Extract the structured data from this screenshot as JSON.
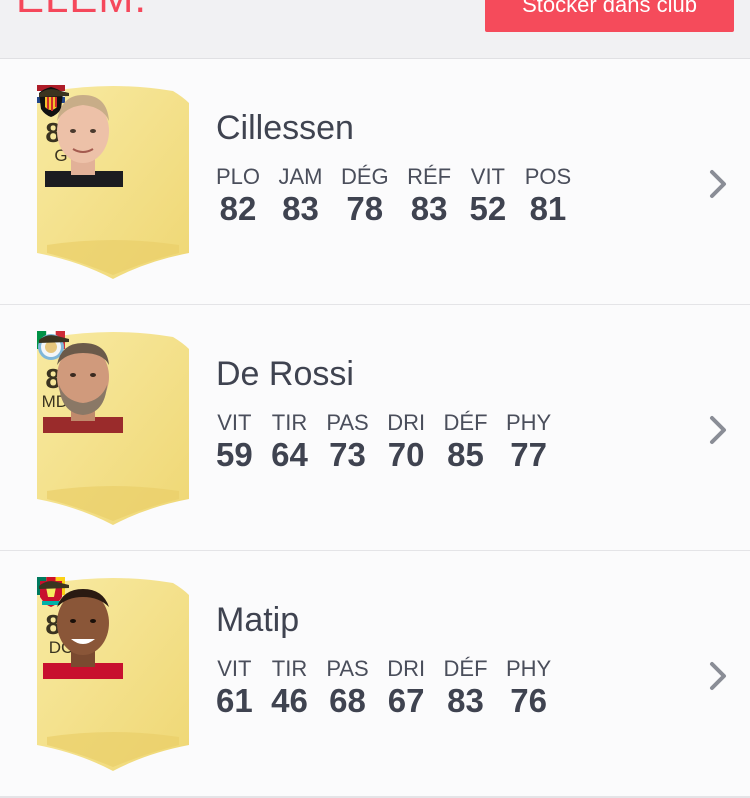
{
  "header": {
    "title": "ÉLÉM.",
    "action_label": "Stocker dans club"
  },
  "players": [
    {
      "name": "Cillessen",
      "rating": "83",
      "position": "G",
      "flag": "netherlands-flag-icon",
      "club": "valencia-crest-icon",
      "stats": [
        {
          "label": "PLO",
          "value": "82"
        },
        {
          "label": "JAM",
          "value": "83"
        },
        {
          "label": "DÉG",
          "value": "78"
        },
        {
          "label": "RÉF",
          "value": "83"
        },
        {
          "label": "VIT",
          "value": "52"
        },
        {
          "label": "POS",
          "value": "81"
        }
      ]
    },
    {
      "name": "De Rossi",
      "rating": "82",
      "position": "MDC",
      "flag": "italy-flag-icon",
      "club": "club-crest-icon",
      "stats": [
        {
          "label": "VIT",
          "value": "59"
        },
        {
          "label": "TIR",
          "value": "64"
        },
        {
          "label": "PAS",
          "value": "73"
        },
        {
          "label": "DRI",
          "value": "70"
        },
        {
          "label": "DÉF",
          "value": "85"
        },
        {
          "label": "PHY",
          "value": "77"
        }
      ]
    },
    {
      "name": "Matip",
      "rating": "82",
      "position": "DC",
      "flag": "cameroon-flag-icon",
      "club": "liverpool-crest-icon",
      "stats": [
        {
          "label": "VIT",
          "value": "61"
        },
        {
          "label": "TIR",
          "value": "46"
        },
        {
          "label": "PAS",
          "value": "68"
        },
        {
          "label": "DRI",
          "value": "67"
        },
        {
          "label": "DÉF",
          "value": "83"
        },
        {
          "label": "PHY",
          "value": "76"
        }
      ]
    }
  ],
  "colors": {
    "accent": "#f54b5b",
    "card_gold": "#f4e48c",
    "text": "#3f4350"
  }
}
